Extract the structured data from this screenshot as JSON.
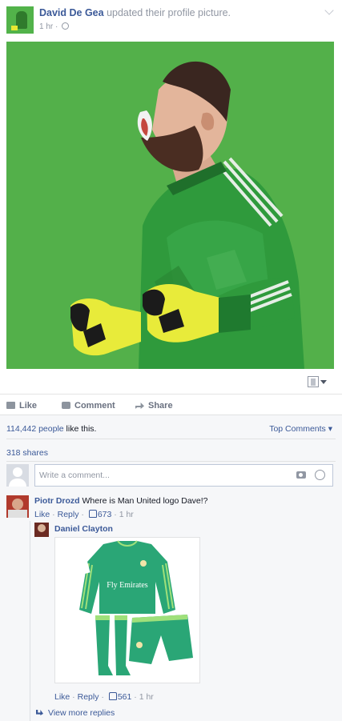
{
  "post": {
    "author": "David De Gea",
    "action": "updated their profile picture.",
    "time": "1 hr",
    "meta_separator": "·"
  },
  "actions": {
    "like": "Like",
    "comment": "Comment",
    "share": "Share"
  },
  "stats": {
    "likes_count": "114,442 people",
    "likes_suffix": "like this.",
    "top_comments": "Top Comments",
    "shares": "318 shares"
  },
  "composer": {
    "placeholder": "Write a comment..."
  },
  "comments": [
    {
      "author": "Piotr Drozd",
      "text": "Where is Man United logo Dave!?",
      "like_label": "Like",
      "reply_label": "Reply",
      "likes": "673",
      "time": "1 hr"
    },
    {
      "author": "Daniel Clayton",
      "kit_text": "Fly Emirates",
      "like_label": "Like",
      "reply_label": "Reply",
      "likes": "561",
      "time": "1 hr"
    }
  ],
  "view_more_replies": "View more replies",
  "colors": {
    "link": "#3b5998",
    "photo_bg": "#53b04a",
    "kit_green": "#2aa676"
  },
  "icons": [
    "chevron-down-icon",
    "globe-icon",
    "tag-icon",
    "like-icon",
    "comment-icon",
    "share-icon",
    "camera-icon",
    "emoji-icon",
    "thumbs-up-icon",
    "reply-arrow-icon"
  ]
}
